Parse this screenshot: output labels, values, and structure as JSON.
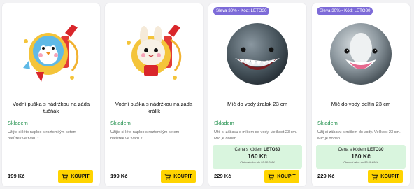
{
  "buy_label": "KOUPIT",
  "products": [
    {
      "title": "Vodní puška s nádržkou na záda tučňák",
      "stock": "Skladem",
      "description": "Užijte si léto naplno s roztomilým setem – batůžek ve tvaru t...",
      "price": "199 Kč",
      "image_icon": "penguin-water-gun-icon"
    },
    {
      "title": "Vodní puška s nádržkou na záda králík",
      "stock": "Skladem",
      "description": "Užijte si léto naplno s roztomilým setem – batůžek ve tvaru k...",
      "price": "199 Kč",
      "image_icon": "rabbit-water-gun-icon"
    },
    {
      "badge": "Sleva 30% - Kód: LETO30",
      "title": "Míč do vody žralok 23 cm",
      "stock": "Skladem",
      "description": "Užij si zábavu s míčem do vody. Velikost 23 cm. Míč je dodán ...",
      "promo": {
        "code_prefix": "Cena s kódem ",
        "code": "LETO30",
        "price": "160 Kč",
        "note": "Platnost akce do 30.08.2024"
      },
      "price": "229 Kč",
      "image_icon": "shark-ball-icon"
    },
    {
      "badge": "Sleva 30% - Kód: LETO30",
      "title": "Míč do vody delfín 23 cm",
      "stock": "Skladem",
      "description": "Užij si zábavu s míčem do vody. Velikost 23 cm. Míč je dodán ...",
      "promo": {
        "code_prefix": "Cena s kódem ",
        "code": "LETO30",
        "price": "160 Kč",
        "note": "Platnost akce do 30.08.2024"
      },
      "price": "229 Kč",
      "image_icon": "dolphin-ball-icon"
    }
  ],
  "colors": {
    "badge": "#7d6bd8",
    "stock": "#1e8e4a",
    "promo_bg": "#d9f5de",
    "buy_button": "#ffd400"
  }
}
